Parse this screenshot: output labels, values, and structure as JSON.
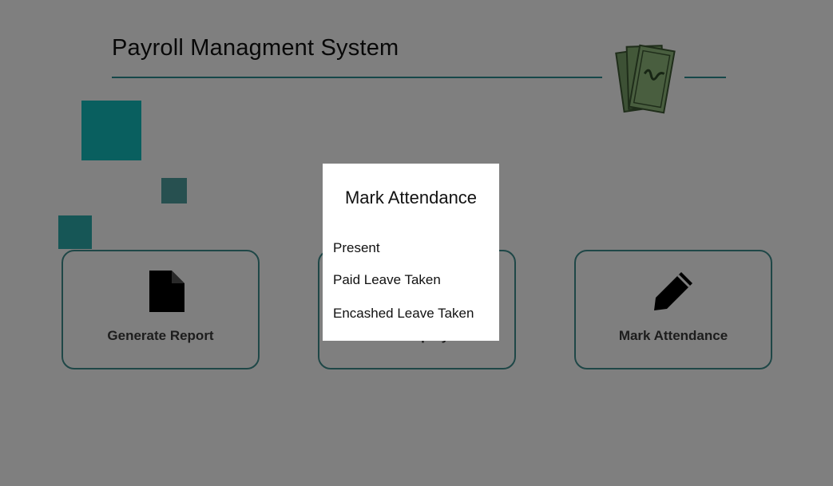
{
  "app": {
    "title": "Payroll Managment System"
  },
  "colors": {
    "accent": "#2c8f93",
    "card_border": "#3e8f8f",
    "overlay": "rgba(0,0,0,0.5)",
    "logo_money": "#7aa26a"
  },
  "logo": {
    "icon": "money-stack-icon"
  },
  "cards": [
    {
      "label": "Generate Report",
      "icon": "document-icon"
    },
    {
      "label": "Add Employee",
      "icon": "user-add-icon"
    },
    {
      "label": "Mark Attendance",
      "icon": "pencil-icon"
    }
  ],
  "modal": {
    "title": "Mark Attendance",
    "options": [
      {
        "label": "Present"
      },
      {
        "label": "Paid Leave Taken"
      },
      {
        "label": "Encashed Leave Taken"
      }
    ]
  }
}
